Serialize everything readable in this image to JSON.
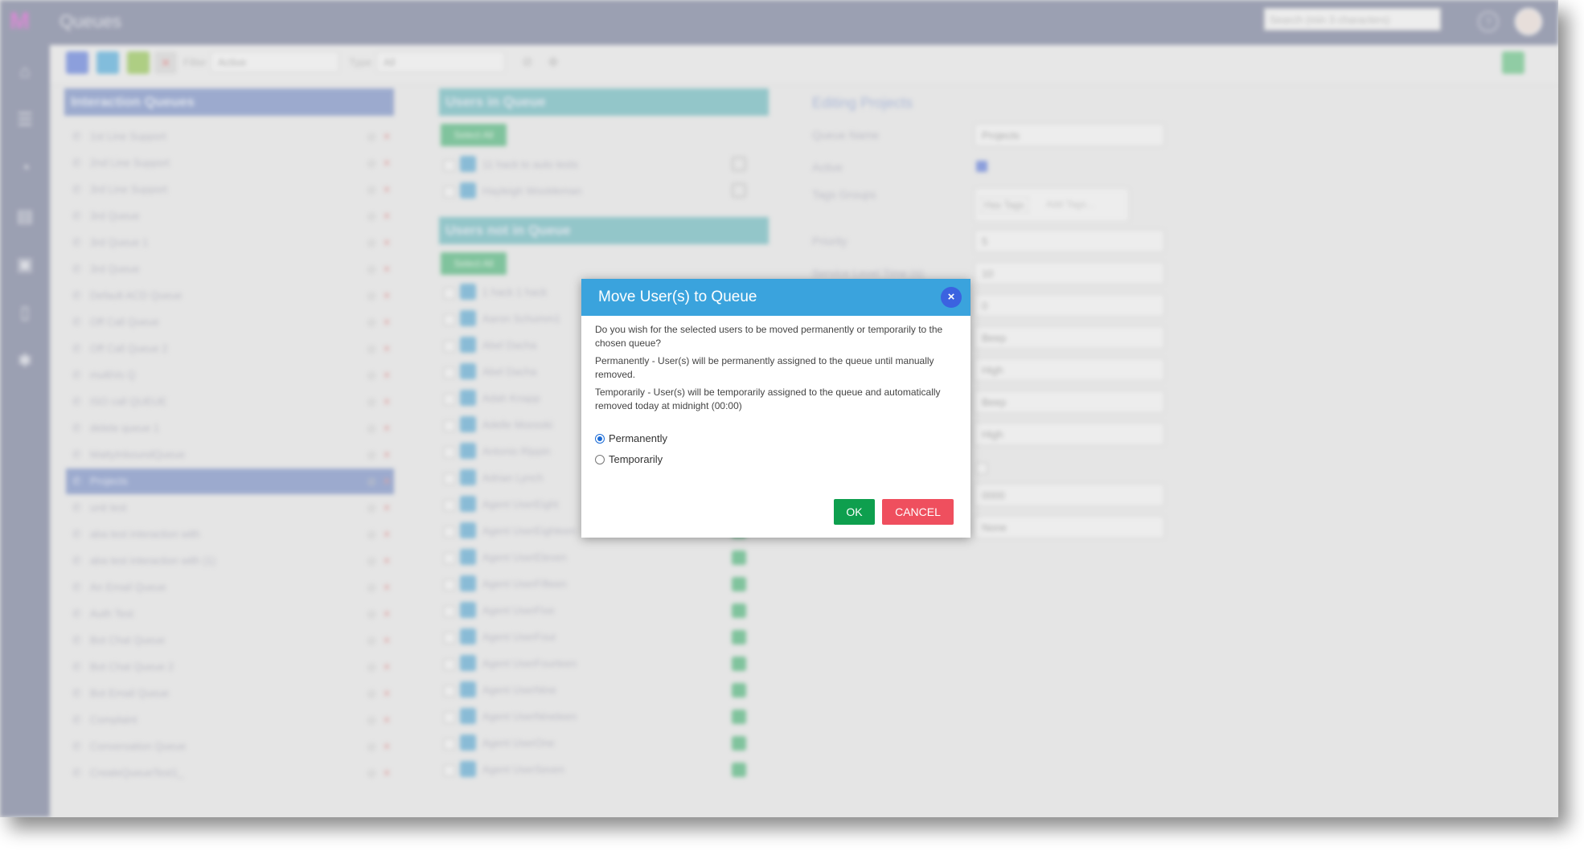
{
  "app": {
    "logo_text": "M",
    "title": "Queues",
    "search_placeholder": "Search (min 3 characters)"
  },
  "toolbar": {
    "filter_label": "Filter",
    "filter_value": "Active",
    "type_label": "Type",
    "type_value": "All"
  },
  "left_panel": {
    "header": "Interaction Queues",
    "items": [
      "1st Line Support",
      "2nd Line Support",
      "3rd Line Support",
      "3rd Queue",
      "3rd Queue 1",
      "3rd Queue",
      "Default ACD Queue",
      "Off Call Queue",
      "Off Call Queue 2",
      "multiVo Q",
      "ISO call QUEUE",
      "delete queue 1",
      "MattyInboundQueue",
      "Projects",
      "unit test",
      "aba test interaction with",
      "aba test interaction with (1)",
      "An Email Queue",
      "Auth Test",
      "Bot Chat Queue",
      "Bot Chat Queue 2",
      "Bot Email Queue",
      "Complaint",
      "Conversation Queue",
      "CreateQueueTest1_"
    ]
  },
  "middle_panel": {
    "in_queue_header": "Users in Queue",
    "not_in_queue_header": "Users not in Queue",
    "select_all_label": "Select All",
    "users_in_queue": [
      "11 hack to auto tests",
      "Hayleigh Wooldeman"
    ],
    "users_not_in_queue": [
      "1 hack 1 hack",
      "Aaron Schumm1",
      "Abel Dacha",
      "Abel Dacha",
      "Adah Knapp",
      "Adelle Moosski",
      "Antonio Rippin",
      "Adrian Lynch",
      "Agent UserEight",
      "Agent UserEighteen",
      "Agent UserEleven",
      "Agent UserFifteen",
      "Agent UserFive",
      "Agent UserFour",
      "Agent UserFourteen",
      "Agent UserNine",
      "Agent UserNineteen",
      "Agent UserOne",
      "Agent UserSeven"
    ]
  },
  "right_panel": {
    "heading": "Editing Projects",
    "labels": [
      "Queue Name",
      "Active",
      "Tags Groups",
      "Priority",
      "Service Level Time (s)"
    ],
    "queue_name": "Projects",
    "tags": [
      "Has Tags",
      "Add Tags..."
    ],
    "priority": "5",
    "service_level_time": "10",
    "field_extra": "0",
    "select_values": [
      "Beep",
      "High",
      "Beep",
      "High"
    ],
    "number_value": "0000",
    "last_select": "None"
  },
  "modal": {
    "title": "Move User(s) to Queue",
    "close_symbol": "×",
    "question": "Do you wish for the selected users to be moved permanently or temporarily to the chosen queue?",
    "permanent_desc": "Permanently - User(s) will be permanently assigned to the queue until manually removed.",
    "temporary_desc": "Temporarily - User(s) will be temporarily assigned to the queue and automatically removed today at midnight (00:00)",
    "options": [
      {
        "label": "Permanently",
        "selected": true
      },
      {
        "label": "Temporarily",
        "selected": false
      }
    ],
    "ok_label": "OK",
    "cancel_label": "CANCEL"
  },
  "colors": {
    "nav": "#6b7394",
    "modal_header": "#3aa3dd",
    "ok": "#0e9f4e",
    "cancel": "#ef4f5e"
  }
}
